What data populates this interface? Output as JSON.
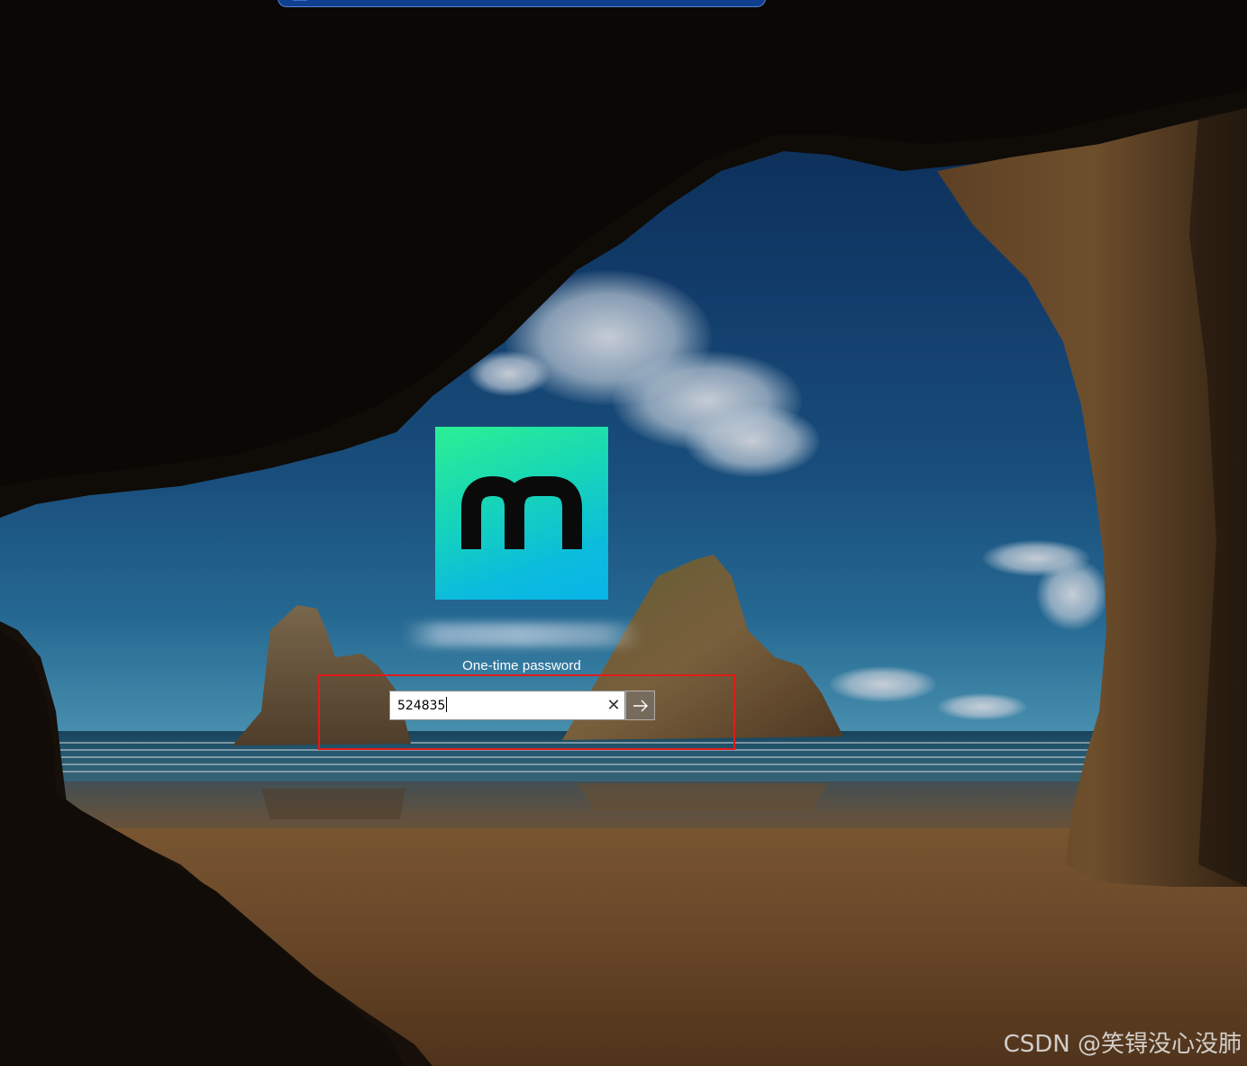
{
  "logo": {
    "letter": "m",
    "colors": [
      "#2cf093",
      "#08b4e8"
    ]
  },
  "username": {
    "value": "",
    "obscured": true
  },
  "otp": {
    "label": "One-time password",
    "value": "524835",
    "clear_icon": "close-icon",
    "submit_icon": "arrow-right-icon"
  },
  "watermark": {
    "text": "CSDN @笑锝没心没肺"
  },
  "colors": {
    "highlight": "#e11b1b",
    "taskbar": "#103f8f"
  }
}
